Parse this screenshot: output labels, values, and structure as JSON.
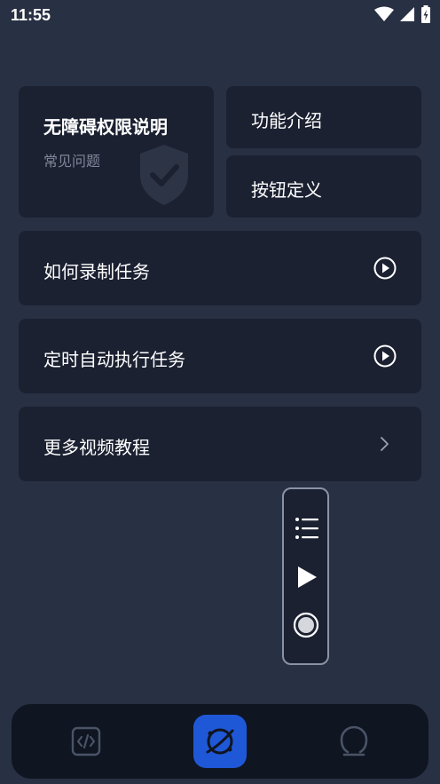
{
  "status_bar": {
    "time": "11:55"
  },
  "cards": {
    "accessibility": {
      "title": "无障碍权限说明",
      "subtitle": "常见问题"
    },
    "features": {
      "label": "功能介绍"
    },
    "buttons": {
      "label": "按钮定义"
    },
    "record_task": {
      "label": "如何录制任务"
    },
    "schedule_task": {
      "label": "定时自动执行任务"
    },
    "more_videos": {
      "label": "更多视频教程"
    }
  },
  "colors": {
    "background": "#283043",
    "card": "#1b2131",
    "accent": "#1f58d6",
    "nav_bg": "#0f1521"
  }
}
